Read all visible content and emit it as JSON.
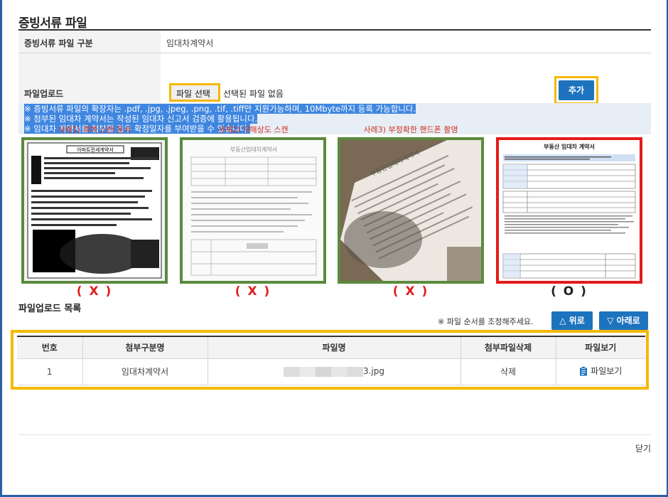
{
  "page": {
    "title": "증빙서류 파일"
  },
  "form": {
    "category_label": "증빙서류 파일 구분",
    "category_value": "임대차계약서",
    "upload_label": "파일업로드",
    "file_button": "파일 선택",
    "file_status": "선택된 파일 없음",
    "add_button": "추가",
    "notices": [
      "※ 증빙서류 파일의 확장자는 .pdf, .jpg, .jpeg, .png, .tif, .tiff만 지원가능하며, 10Mbyte까지 등록 가능합니다.",
      "※ 첨부된 임대차 계약서는 작성된 임대차 신고서 검증에 활용됩니다.",
      "※ 임대차 계약서를 첨부할 경우 확정일자를 부여받을 수 있습니다."
    ]
  },
  "examples": [
    {
      "label": "사례1) 흑백 스캔 문서",
      "mark": "( X )",
      "doc_title": "아파트전세계약서"
    },
    {
      "label": "사례2) 저해상도 스캔",
      "mark": "( X )",
      "doc_title": "부동산임대차계약서"
    },
    {
      "label": "사례3) 부정확한 핸드폰 촬영",
      "mark": "( X )",
      "doc_title": "부동산임대차계약서"
    },
    {
      "label": "",
      "mark": "( O )",
      "doc_title": "부동산 임대차 계약서"
    }
  ],
  "uploads": {
    "title": "파일업로드 목록",
    "order_note": "※ 파일 순서를 조정해주세요.",
    "up_button": "△ 위로",
    "down_button": "▽ 아래로",
    "columns": [
      "번호",
      "첨부구분명",
      "파일명",
      "첨부파일삭제",
      "파일보기"
    ],
    "rows": [
      {
        "no": "1",
        "category": "임대차계약서",
        "filename_suffix": "3.jpg",
        "delete": "삭제",
        "view": "파일보기"
      }
    ]
  },
  "footer": {
    "close": "닫기"
  },
  "colors": {
    "accent": "#1d73be",
    "highlight": "#f5b800",
    "bad_border": "#5b8a3c",
    "good_border": "#e31b1b",
    "warning_text": "#d3301f"
  }
}
